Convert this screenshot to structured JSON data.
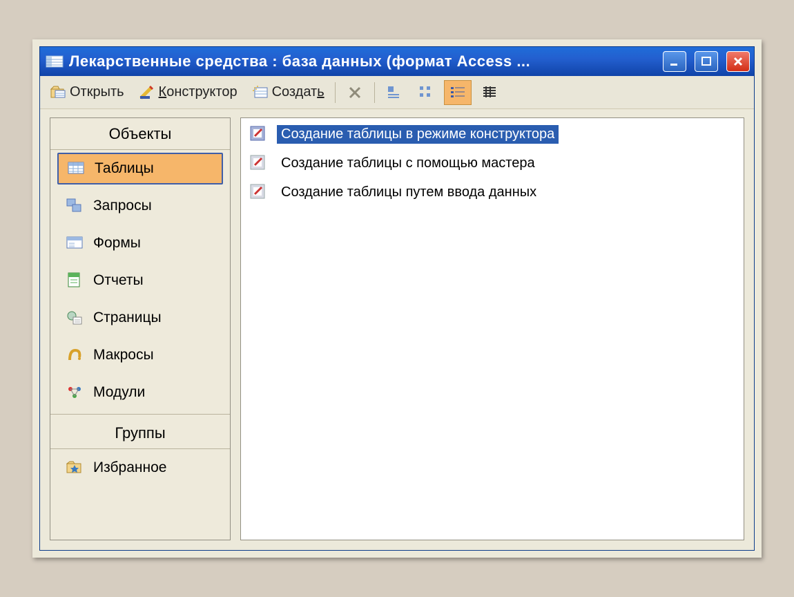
{
  "window": {
    "title": "Лекарственные средства : база данных (формат Access ..."
  },
  "toolbar": {
    "open": "Открыть",
    "design": "Конструктор",
    "create": "Создать"
  },
  "sidebar": {
    "objects_header": "Объекты",
    "groups_header": "Группы",
    "items": [
      {
        "label": "Таблицы"
      },
      {
        "label": "Запросы"
      },
      {
        "label": "Формы"
      },
      {
        "label": "Отчеты"
      },
      {
        "label": "Страницы"
      },
      {
        "label": "Макросы"
      },
      {
        "label": "Модули"
      }
    ],
    "favorites": "Избранное"
  },
  "content": {
    "rows": [
      {
        "label": "Создание таблицы в режиме конструктора",
        "selected": true
      },
      {
        "label": "Создание таблицы с помощью мастера",
        "selected": false
      },
      {
        "label": "Создание таблицы путем ввода данных",
        "selected": false
      }
    ]
  }
}
